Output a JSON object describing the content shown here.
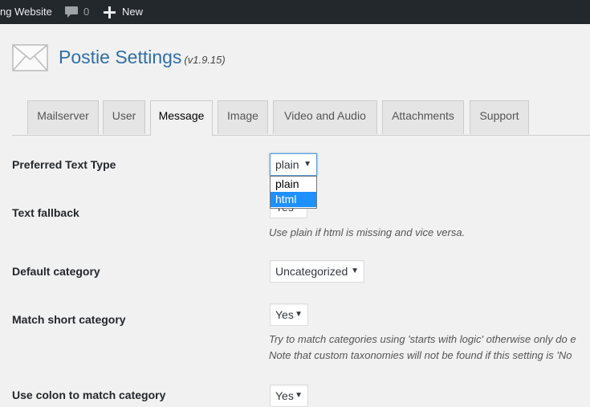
{
  "adminbar": {
    "site_name": "ng Website",
    "comments_count": "0",
    "new_label": "New"
  },
  "header": {
    "title": "Postie Settings",
    "version": "(v1.9.15)"
  },
  "tabs": [
    {
      "label": "Mailserver"
    },
    {
      "label": "User"
    },
    {
      "label": "Message"
    },
    {
      "label": "Image"
    },
    {
      "label": "Video and Audio"
    },
    {
      "label": "Attachments"
    },
    {
      "label": "Support"
    }
  ],
  "active_tab": "Message",
  "settings": {
    "preferred_text_type": {
      "label": "Preferred Text Type",
      "value": "plain",
      "options": [
        "plain",
        "html"
      ],
      "highlighted_option": "html"
    },
    "text_fallback": {
      "label": "Text fallback",
      "value": "Yes",
      "description": "Use plain if html is missing and vice versa."
    },
    "default_category": {
      "label": "Default category",
      "value": "Uncategorized"
    },
    "match_short_category": {
      "label": "Match short category",
      "value": "Yes",
      "description_1": "Try to match categories using 'starts with logic' otherwise only do e",
      "description_2": "Note that custom taxonomies will not be found if this setting is 'No"
    },
    "use_colon": {
      "label": "Use colon to match category",
      "value": "Yes"
    }
  },
  "colors": {
    "admin_bar_bg": "#23282d",
    "title_blue": "#2f6fa7",
    "dropdown_highlight": "#1e90ff",
    "focus_border": "#5b9dd9"
  }
}
